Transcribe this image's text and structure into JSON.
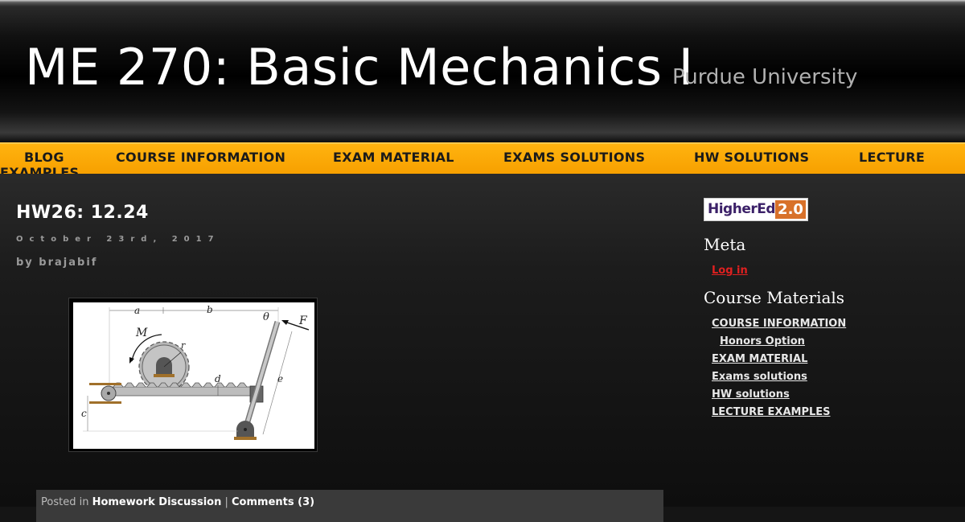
{
  "header": {
    "title": "ME 270: Basic Mechanics I",
    "subtitle": "Purdue University"
  },
  "nav": {
    "items": [
      {
        "label": "BLOG"
      },
      {
        "label": "COURSE INFORMATION"
      },
      {
        "label": "EXAM MATERIAL"
      },
      {
        "label": "EXAMS SOLUTIONS"
      },
      {
        "label": "HW SOLUTIONS"
      },
      {
        "label": "LECTURE"
      }
    ],
    "overflow_label": "EXAMPLES"
  },
  "post": {
    "title": "HW26: 12.24",
    "date": "October 23rd, 2017",
    "author": "by brajabif",
    "figure_labels": {
      "a": "a",
      "b": "b",
      "theta": "θ",
      "F": "F",
      "M": "M",
      "r": "r",
      "d": "d",
      "e": "e",
      "c": "c"
    },
    "footer": {
      "posted_in": "Posted in",
      "category": "Homework Discussion",
      "separator": "|",
      "comments": "Comments (3)"
    }
  },
  "sidebar": {
    "badge": {
      "text": "HigherEd",
      "version": "2.0"
    },
    "meta_heading": "Meta",
    "login": "Log in",
    "materials_heading": "Course Materials",
    "materials": [
      {
        "label": "COURSE INFORMATION"
      },
      {
        "label": "Honors Option"
      },
      {
        "label": "EXAM MATERIAL"
      },
      {
        "label": "Exams solutions"
      },
      {
        "label": "HW solutions"
      },
      {
        "label": "LECTURE EXAMPLES"
      }
    ]
  },
  "colors": {
    "nav_bg": "#f7a000",
    "login_link": "#e02020",
    "badge_accent": "#d8712a"
  }
}
